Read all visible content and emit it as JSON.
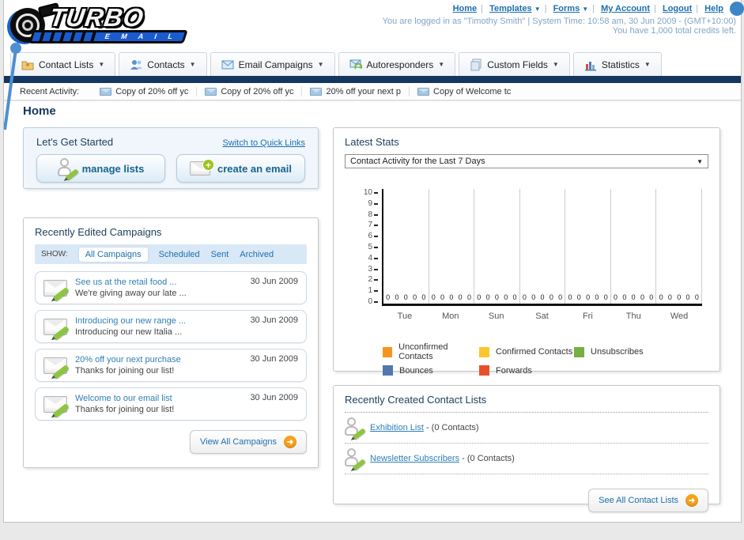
{
  "header": {
    "logo_line1": "TURBO",
    "logo_line2": "E M A I L",
    "nav_links": [
      "Home",
      "Templates",
      "Forms",
      "My Account",
      "Logout",
      "Help"
    ],
    "login_info": "You are logged in as \"Timothy Smith\" | System Time: 10:58 am, 30 Jun 2009 - (GMT+10:00)",
    "credits_info": "You have 1,000 total credits left."
  },
  "tabs": [
    {
      "label": "Contact Lists"
    },
    {
      "label": "Contacts"
    },
    {
      "label": "Email Campaigns"
    },
    {
      "label": "Autoresponders"
    },
    {
      "label": "Custom Fields"
    },
    {
      "label": "Statistics"
    }
  ],
  "recent_activity": {
    "label": "Recent Activity:",
    "items": [
      "Copy of 20% off yc",
      "Copy of 20% off yc",
      "20% off your next p",
      "Copy of Welcome tc"
    ]
  },
  "page_title": "Home",
  "get_started": {
    "title": "Let's Get Started",
    "switch_link": "Switch to Quick Links",
    "manage_lists_label": "manage lists",
    "create_email_label": "create an email"
  },
  "campaigns": {
    "title": "Recently Edited Campaigns",
    "show_label": "SHOW:",
    "filters": [
      "All Campaigns",
      "Scheduled",
      "Sent",
      "Archived"
    ],
    "active_filter": "All Campaigns",
    "items": [
      {
        "title": "See us at the retail food ...",
        "subtitle": "We're giving away our late ...",
        "date": "30 Jun 2009"
      },
      {
        "title": "Introducing our new range ...",
        "subtitle": "Introducing our new Italia ...",
        "date": "30 Jun 2009"
      },
      {
        "title": "20% off your next purchase",
        "subtitle": "Thanks for joining our list!",
        "date": "30 Jun 2009"
      },
      {
        "title": "Welcome to our email list",
        "subtitle": "Thanks for joining our list!",
        "date": "30 Jun 2009"
      }
    ],
    "view_all_label": "View All Campaigns"
  },
  "latest_stats": {
    "title": "Latest Stats",
    "dropdown_value": "Contact Activity for the Last 7 Days"
  },
  "chart_data": {
    "type": "bar",
    "title": "Contact Activity for the Last 7 Days",
    "categories": [
      "Tue",
      "Mon",
      "Sun",
      "Sat",
      "Fri",
      "Thu",
      "Wed"
    ],
    "series": [
      {
        "name": "Unconfirmed Contacts",
        "color": "#f7941e",
        "values": [
          0,
          0,
          0,
          0,
          0,
          0,
          0
        ]
      },
      {
        "name": "Confirmed Contacts",
        "color": "#fdc62f",
        "values": [
          0,
          0,
          0,
          0,
          0,
          0,
          0
        ]
      },
      {
        "name": "Unsubscribes",
        "color": "#76b043",
        "values": [
          0,
          0,
          0,
          0,
          0,
          0,
          0
        ]
      },
      {
        "name": "Bounces",
        "color": "#5377ab",
        "values": [
          0,
          0,
          0,
          0,
          0,
          0,
          0
        ]
      },
      {
        "name": "Forwards",
        "color": "#e8502b",
        "values": [
          0,
          0,
          0,
          0,
          0,
          0,
          0
        ]
      }
    ],
    "xlabel": "",
    "ylabel": "",
    "ylim": [
      0,
      10
    ],
    "yticks": [
      0,
      1,
      2,
      3,
      4,
      5,
      6,
      7,
      8,
      9,
      10
    ],
    "grid": true,
    "legend_position": "bottom"
  },
  "contact_lists": {
    "title": "Recently Created Contact Lists",
    "items": [
      {
        "name": "Exhibition List",
        "suffix": "- (0 Contacts)"
      },
      {
        "name": "Newsletter Subscribers",
        "suffix": "- (0 Contacts)"
      }
    ],
    "see_all_label": "See All Contact Lists"
  }
}
